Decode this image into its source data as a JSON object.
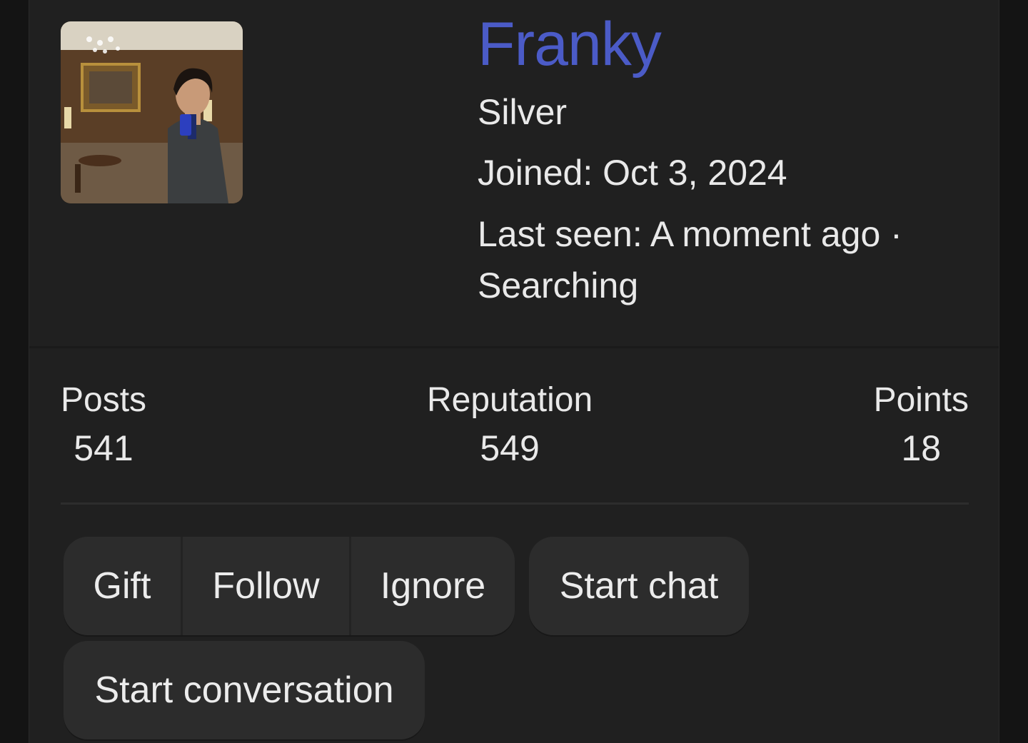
{
  "profile": {
    "username": "Franky",
    "username_color": "#4b5bc7",
    "rank": "Silver",
    "joined": "Joined: Oct 3, 2024",
    "last_seen": "Last seen: A moment ago · Searching"
  },
  "stats": {
    "posts": {
      "label": "Posts",
      "value": "541"
    },
    "reputation": {
      "label": "Reputation",
      "value": "549"
    },
    "points": {
      "label": "Points",
      "value": "18"
    }
  },
  "actions": {
    "gift": "Gift",
    "follow": "Follow",
    "ignore": "Ignore",
    "start_chat": "Start chat",
    "start_conversation": "Start conversation"
  }
}
